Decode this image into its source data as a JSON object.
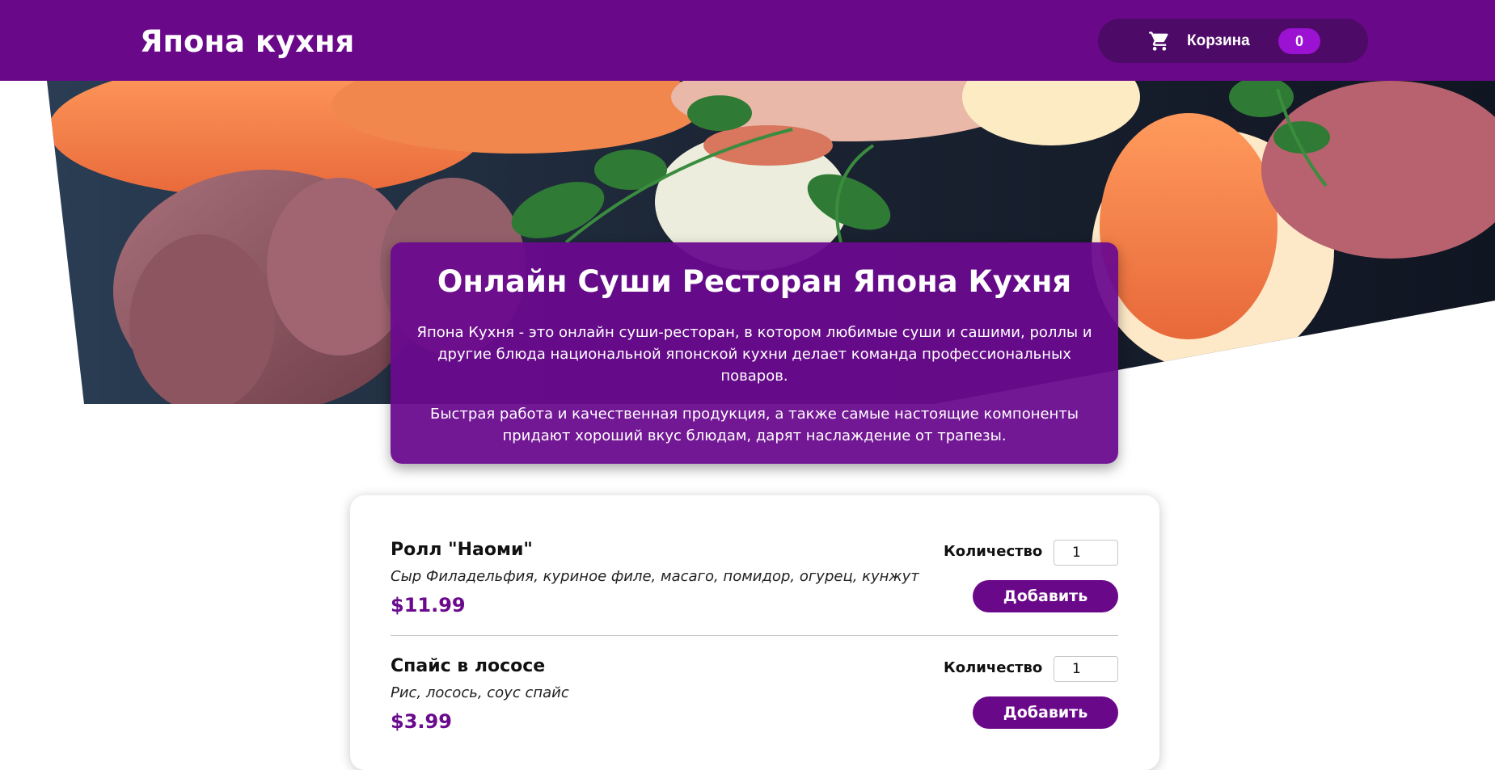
{
  "header": {
    "logo": "Япона кухня",
    "cart": {
      "label": "Корзина",
      "count": "0",
      "icon": "cart-icon"
    }
  },
  "colors": {
    "brand": "#6a088a",
    "cart_bg": "#4d0a66",
    "badge": "#9b12d2",
    "price": "#6a0a8c"
  },
  "summary": {
    "title": "Онлайн Суши Ресторан Япона Кухня",
    "paragraphs": [
      "Япона Кухня - это онлайн суши-ресторан, в котором любимые суши и сашими, роллы и другие блюда национальной японской кухни делает команда профессиональных поваров.",
      "Быстрая работа и качественная продукция, а также самые настоящие компоненты придают хороший вкус блюдам, дарят наслаждение от трапезы."
    ]
  },
  "meals": [
    {
      "name": "Ролл \"Наоми\"",
      "description": "Сыр Филадельфия, куриное филе, масаго, помидор, огурец, кунжут",
      "price": "$11.99",
      "quantity_label": "Количество",
      "quantity": "1",
      "add_label": "Добавить"
    },
    {
      "name": "Спайс в лососе",
      "description": "Рис, лосось, соус спайс",
      "price": "$3.99",
      "quantity_label": "Количество",
      "quantity": "1",
      "add_label": "Добавить"
    }
  ]
}
